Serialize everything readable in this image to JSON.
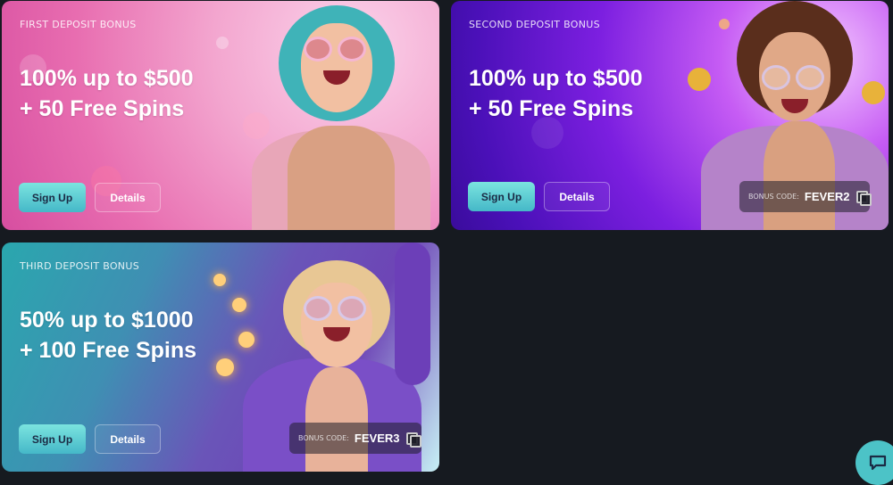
{
  "cards": [
    {
      "label": "FIRST DEPOSIT BONUS",
      "line1": "100% up to $500",
      "line2": "+ 50 Free Spins",
      "signup": "Sign Up",
      "details": "Details"
    },
    {
      "label": "SECOND DEPOSIT BONUS",
      "line1": "100% up to $500",
      "line2": "+ 50 Free Spins",
      "signup": "Sign Up",
      "details": "Details",
      "code_label": "BONUS CODE:",
      "code": "FEVER2"
    },
    {
      "label": "THIRD DEPOSIT BONUS",
      "line1": "50% up to $1000",
      "line2": "+ 100 Free Spins",
      "signup": "Sign Up",
      "details": "Details",
      "code_label": "BONUS CODE:",
      "code": "FEVER3"
    }
  ],
  "chat": {
    "icon": "chat-bubble-icon"
  },
  "colors": {
    "background": "#161a20",
    "signup_button": "#5fcfd3",
    "card1": "#e86db0",
    "card2": "#5a14c8",
    "card3": "#4a8fb5"
  }
}
